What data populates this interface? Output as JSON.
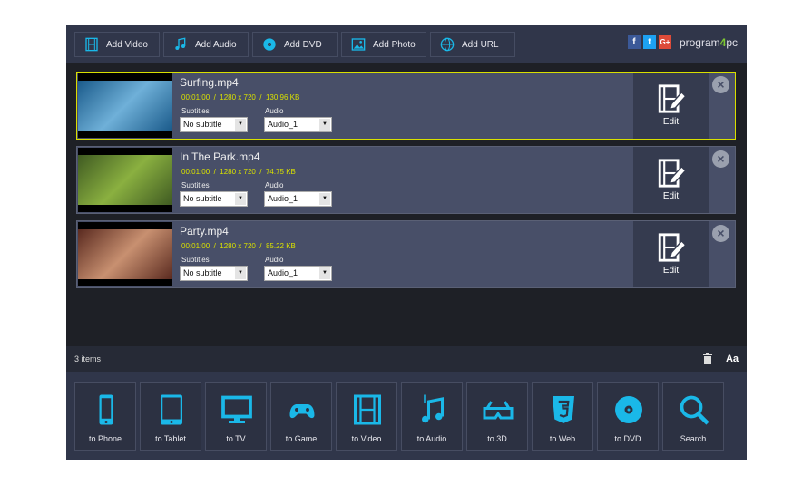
{
  "toolbar": {
    "buttons": [
      {
        "label": "Add Video",
        "icon": "film-icon"
      },
      {
        "label": "Add Audio",
        "icon": "music-icon"
      },
      {
        "label": "Add DVD",
        "icon": "disc-icon"
      },
      {
        "label": "Add Photo",
        "icon": "photo-icon"
      },
      {
        "label": "Add URL",
        "icon": "globe-icon"
      }
    ],
    "social": [
      "f",
      "t",
      "G+"
    ],
    "logo": {
      "pre": "program",
      "mid": "4",
      "post": "pc"
    }
  },
  "items": [
    {
      "name": "Surfing.mp4",
      "meta": "00:01:00  /  1280 x 720  /  130.96 KB",
      "subtitles_label": "Subtitles",
      "subtitle": "No subtitle",
      "audio_label": "Audio",
      "audio": "Audio_1",
      "edit": "Edit",
      "thumb_colors": [
        "#1a5a8a",
        "#6fb0d8"
      ]
    },
    {
      "name": "In The Park.mp4",
      "meta": "00:01:00  /  1280 x 720  /  74.75 KB",
      "subtitles_label": "Subtitles",
      "subtitle": "No subtitle",
      "audio_label": "Audio",
      "audio": "Audio_1",
      "edit": "Edit",
      "thumb_colors": [
        "#3f5a22",
        "#8ab040"
      ]
    },
    {
      "name": "Party.mp4",
      "meta": "00:01:00  /  1280 x 720  /  85.22 KB",
      "subtitles_label": "Subtitles",
      "subtitle": "No subtitle",
      "audio_label": "Audio",
      "audio": "Audio_1",
      "edit": "Edit",
      "thumb_colors": [
        "#5a2a20",
        "#c89070"
      ]
    }
  ],
  "status": {
    "count": "3  items",
    "font_button": "Aa"
  },
  "outputs": [
    {
      "label": "to Phone"
    },
    {
      "label": "to Tablet"
    },
    {
      "label": "to TV"
    },
    {
      "label": "to Game"
    },
    {
      "label": "to Video"
    },
    {
      "label": "to Audio"
    },
    {
      "label": "to 3D"
    },
    {
      "label": "to Web"
    },
    {
      "label": "to DVD"
    },
    {
      "label": "Search"
    }
  ],
  "colors": {
    "accent": "#1ab8e8",
    "meta": "#d8e000"
  }
}
